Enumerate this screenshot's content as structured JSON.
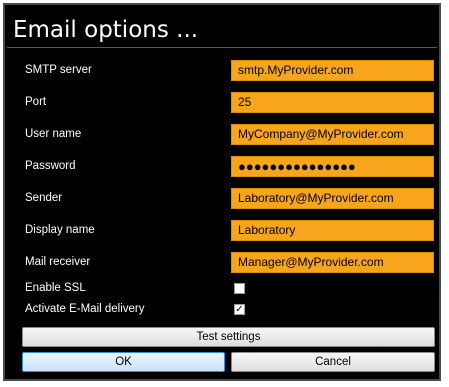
{
  "dialog": {
    "title": "Email options ...",
    "fields": [
      {
        "label": "SMTP server",
        "value": "smtp.MyProvider.com"
      },
      {
        "label": "Port",
        "value": "25"
      },
      {
        "label": "User name",
        "value": "MyCompany@MyProvider.com"
      },
      {
        "label": "Password",
        "value": "●●●●●●●●●●●●●●●"
      },
      {
        "label": "Sender",
        "value": "Laboratory@MyProvider.com"
      },
      {
        "label": "Display name",
        "value": "Laboratory"
      },
      {
        "label": "Mail receiver",
        "value": "Manager@MyProvider.com"
      }
    ],
    "checkboxes": [
      {
        "label": "Enable SSL",
        "checked": false,
        "mark": ""
      },
      {
        "label": "Activate E-Mail delivery",
        "checked": true,
        "mark": "✓"
      }
    ],
    "buttons": {
      "test": "Test settings",
      "ok": "OK",
      "cancel": "Cancel"
    }
  },
  "colors": {
    "field_bg": "#f7a51c",
    "dialog_bg": "#000000",
    "text": "#ffffff"
  }
}
